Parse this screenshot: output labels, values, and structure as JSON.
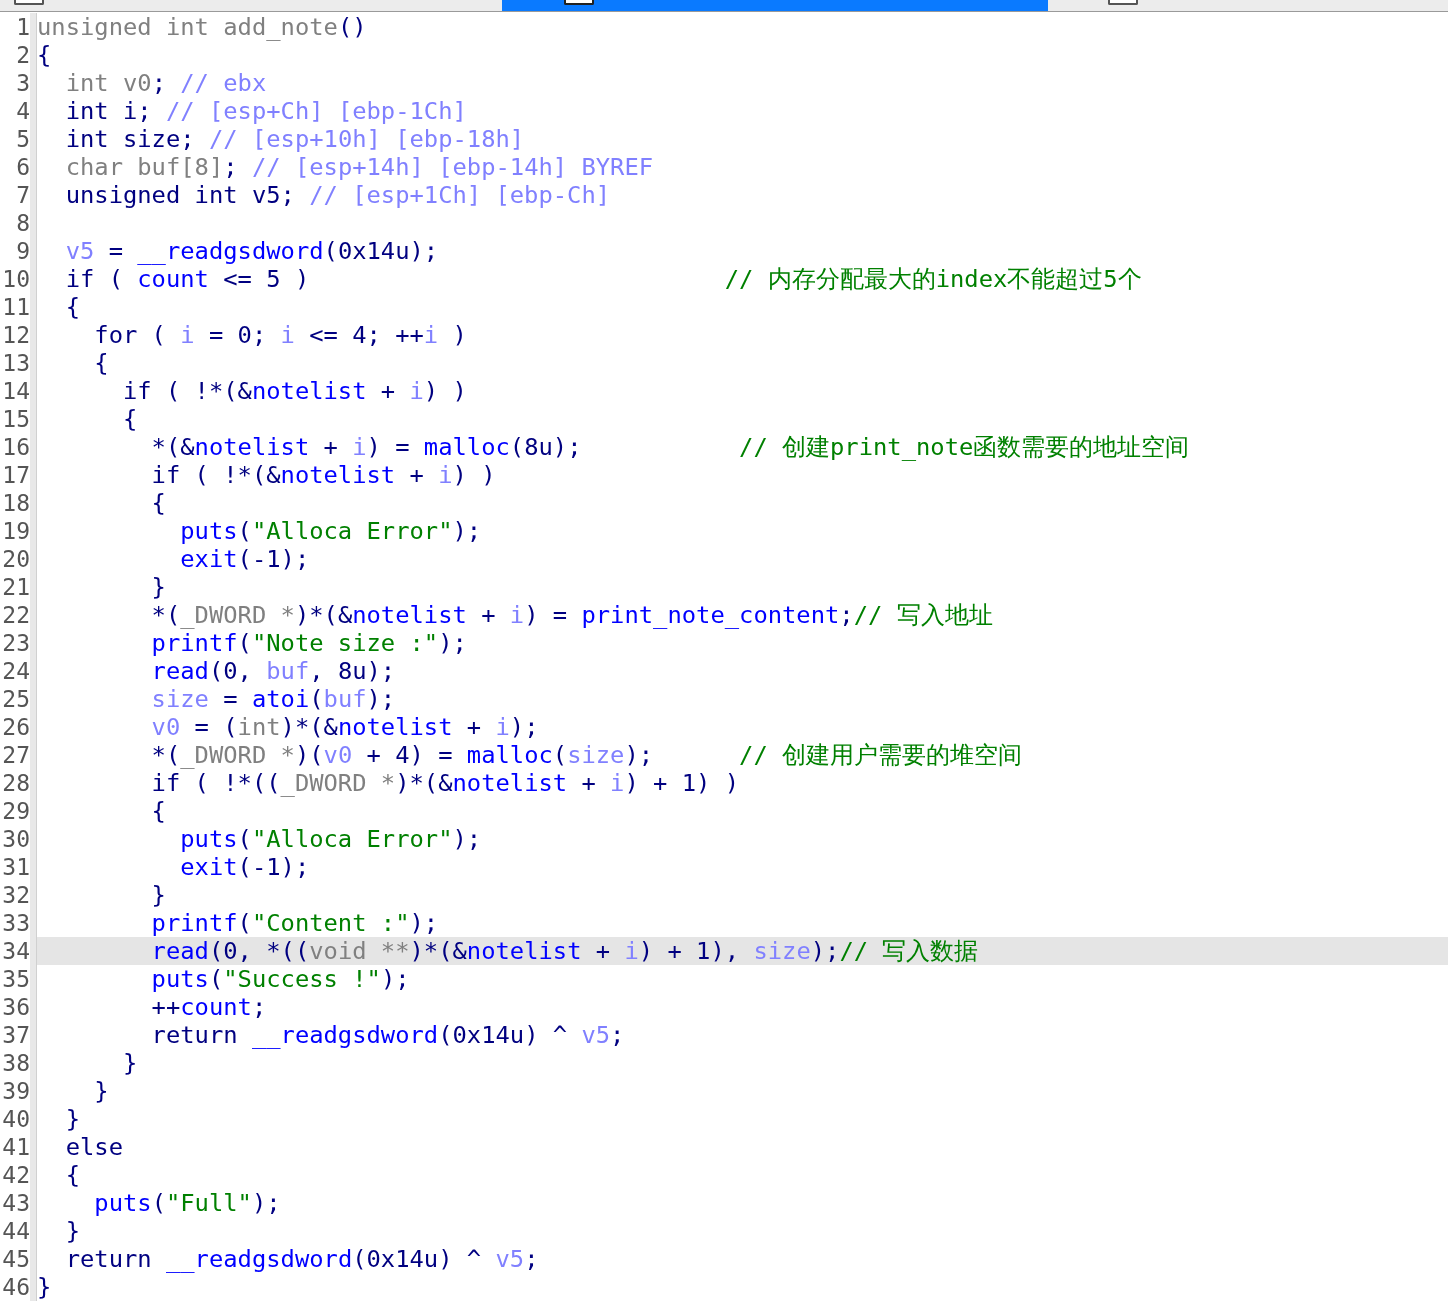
{
  "tabs": [
    {
      "selected": false
    },
    {
      "selected": true
    },
    {
      "selected": false
    }
  ],
  "lines": [
    {
      "n": "1",
      "selected": false,
      "seg": [
        {
          "kind": "type",
          "text": "unsigned int add_note"
        },
        {
          "kind": "plain",
          "text": "()"
        }
      ]
    },
    {
      "n": "2",
      "selected": false,
      "seg": [
        {
          "kind": "plain",
          "text": "{"
        }
      ]
    },
    {
      "n": "3",
      "selected": false,
      "seg": [
        {
          "kind": "type",
          "text": "  int v0"
        },
        {
          "kind": "plain",
          "text": ";"
        },
        {
          "kind": "varcomment",
          "text": " // ebx"
        }
      ]
    },
    {
      "n": "4",
      "selected": false,
      "seg": [
        {
          "kind": "plain",
          "text": "  int i;"
        },
        {
          "kind": "varcomment",
          "text": " // [esp+Ch] [ebp-1Ch]"
        }
      ]
    },
    {
      "n": "5",
      "selected": false,
      "seg": [
        {
          "kind": "plain",
          "text": "  int size;"
        },
        {
          "kind": "varcomment",
          "text": " // [esp+10h] [ebp-18h]"
        }
      ]
    },
    {
      "n": "6",
      "selected": false,
      "seg": [
        {
          "kind": "type",
          "text": "  char buf[8]"
        },
        {
          "kind": "plain",
          "text": ";"
        },
        {
          "kind": "varcomment",
          "text": " // [esp+14h] [ebp-14h] BYREF"
        }
      ]
    },
    {
      "n": "7",
      "selected": false,
      "seg": [
        {
          "kind": "plain",
          "text": "  unsigned int v5;"
        },
        {
          "kind": "varcomment",
          "text": " // [esp+1Ch] [ebp-Ch]"
        }
      ]
    },
    {
      "n": "8",
      "selected": false
    },
    {
      "n": "9",
      "selected": false,
      "seg": [
        {
          "kind": "var",
          "text": "  v5"
        },
        {
          "kind": "plain",
          "text": " = "
        },
        {
          "kind": "fn",
          "text": "__readgsdword"
        },
        {
          "kind": "plain",
          "text": "(0x14u);"
        }
      ]
    },
    {
      "n": "10",
      "selected": false,
      "seg": [
        {
          "kind": "plain",
          "text": "  if ( "
        },
        {
          "kind": "fn",
          "text": "count"
        },
        {
          "kind": "plain",
          "text": " <= 5 )                             "
        },
        {
          "kind": "comment",
          "text": "// 内存分配最大的index不能超过5个"
        }
      ]
    },
    {
      "n": "11",
      "selected": false,
      "seg": [
        {
          "kind": "plain",
          "text": "  {"
        }
      ]
    },
    {
      "n": "12",
      "selected": false,
      "seg": [
        {
          "kind": "plain",
          "text": "    for ( "
        },
        {
          "kind": "var",
          "text": "i"
        },
        {
          "kind": "plain",
          "text": " = 0; "
        },
        {
          "kind": "var",
          "text": "i"
        },
        {
          "kind": "plain",
          "text": " <= 4; ++"
        },
        {
          "kind": "var",
          "text": "i"
        },
        {
          "kind": "plain",
          "text": " )"
        }
      ]
    },
    {
      "n": "13",
      "selected": false,
      "seg": [
        {
          "kind": "plain",
          "text": "    {"
        }
      ]
    },
    {
      "n": "14",
      "selected": false,
      "seg": [
        {
          "kind": "plain",
          "text": "      if ( !*(&"
        },
        {
          "kind": "fn",
          "text": "notelist"
        },
        {
          "kind": "plain",
          "text": " + "
        },
        {
          "kind": "var",
          "text": "i"
        },
        {
          "kind": "plain",
          "text": ") )"
        }
      ]
    },
    {
      "n": "15",
      "selected": false,
      "seg": [
        {
          "kind": "plain",
          "text": "      {"
        }
      ]
    },
    {
      "n": "16",
      "selected": false,
      "seg": [
        {
          "kind": "plain",
          "text": "        *(&"
        },
        {
          "kind": "fn",
          "text": "notelist"
        },
        {
          "kind": "plain",
          "text": " + "
        },
        {
          "kind": "var",
          "text": "i"
        },
        {
          "kind": "plain",
          "text": ") = "
        },
        {
          "kind": "fn",
          "text": "malloc"
        },
        {
          "kind": "plain",
          "text": "(8u);           "
        },
        {
          "kind": "comment",
          "text": "// 创建print_note函数需要的地址空间"
        }
      ]
    },
    {
      "n": "17",
      "selected": false,
      "seg": [
        {
          "kind": "plain",
          "text": "        if ( !*(&"
        },
        {
          "kind": "fn",
          "text": "notelist"
        },
        {
          "kind": "plain",
          "text": " + "
        },
        {
          "kind": "var",
          "text": "i"
        },
        {
          "kind": "plain",
          "text": ") )"
        }
      ]
    },
    {
      "n": "18",
      "selected": false,
      "seg": [
        {
          "kind": "plain",
          "text": "        {"
        }
      ]
    },
    {
      "n": "19",
      "selected": false,
      "seg": [
        {
          "kind": "fn",
          "text": "          puts"
        },
        {
          "kind": "plain",
          "text": "("
        },
        {
          "kind": "string",
          "text": "\"Alloca Error\""
        },
        {
          "kind": "plain",
          "text": ");"
        }
      ]
    },
    {
      "n": "20",
      "selected": false,
      "seg": [
        {
          "kind": "fn",
          "text": "          exit"
        },
        {
          "kind": "plain",
          "text": "(-1);"
        }
      ]
    },
    {
      "n": "21",
      "selected": false,
      "seg": [
        {
          "kind": "plain",
          "text": "        }"
        }
      ]
    },
    {
      "n": "22",
      "selected": false,
      "seg": [
        {
          "kind": "plain",
          "text": "        *("
        },
        {
          "kind": "type",
          "text": "_DWORD *"
        },
        {
          "kind": "plain",
          "text": ")*(&"
        },
        {
          "kind": "fn",
          "text": "notelist"
        },
        {
          "kind": "plain",
          "text": " + "
        },
        {
          "kind": "var",
          "text": "i"
        },
        {
          "kind": "plain",
          "text": ") = "
        },
        {
          "kind": "fn",
          "text": "print_note_content"
        },
        {
          "kind": "plain",
          "text": ";"
        },
        {
          "kind": "comment",
          "text": "// 写入地址"
        }
      ]
    },
    {
      "n": "23",
      "selected": false,
      "seg": [
        {
          "kind": "fn",
          "text": "        printf"
        },
        {
          "kind": "plain",
          "text": "("
        },
        {
          "kind": "string",
          "text": "\"Note size :\""
        },
        {
          "kind": "plain",
          "text": ");"
        }
      ]
    },
    {
      "n": "24",
      "selected": false,
      "seg": [
        {
          "kind": "fn",
          "text": "        read"
        },
        {
          "kind": "plain",
          "text": "(0, "
        },
        {
          "kind": "var",
          "text": "buf"
        },
        {
          "kind": "plain",
          "text": ", 8u);"
        }
      ]
    },
    {
      "n": "25",
      "selected": false,
      "seg": [
        {
          "kind": "var",
          "text": "        size"
        },
        {
          "kind": "plain",
          "text": " = "
        },
        {
          "kind": "fn",
          "text": "atoi"
        },
        {
          "kind": "plain",
          "text": "("
        },
        {
          "kind": "var",
          "text": "buf"
        },
        {
          "kind": "plain",
          "text": ");"
        }
      ]
    },
    {
      "n": "26",
      "selected": false,
      "seg": [
        {
          "kind": "var",
          "text": "        v0"
        },
        {
          "kind": "plain",
          "text": " = ("
        },
        {
          "kind": "type",
          "text": "int"
        },
        {
          "kind": "plain",
          "text": ")*(&"
        },
        {
          "kind": "fn",
          "text": "notelist"
        },
        {
          "kind": "plain",
          "text": " + "
        },
        {
          "kind": "var",
          "text": "i"
        },
        {
          "kind": "plain",
          "text": ");"
        }
      ]
    },
    {
      "n": "27",
      "selected": false,
      "seg": [
        {
          "kind": "plain",
          "text": "        *("
        },
        {
          "kind": "type",
          "text": "_DWORD *"
        },
        {
          "kind": "plain",
          "text": ")("
        },
        {
          "kind": "var",
          "text": "v0"
        },
        {
          "kind": "plain",
          "text": " + 4) = "
        },
        {
          "kind": "fn",
          "text": "malloc"
        },
        {
          "kind": "plain",
          "text": "("
        },
        {
          "kind": "var",
          "text": "size"
        },
        {
          "kind": "plain",
          "text": ");      "
        },
        {
          "kind": "comment",
          "text": "// 创建用户需要的堆空间"
        }
      ]
    },
    {
      "n": "28",
      "selected": false,
      "seg": [
        {
          "kind": "plain",
          "text": "        if ( !*(("
        },
        {
          "kind": "type",
          "text": "_DWORD *"
        },
        {
          "kind": "plain",
          "text": ")*(&"
        },
        {
          "kind": "fn",
          "text": "notelist"
        },
        {
          "kind": "plain",
          "text": " + "
        },
        {
          "kind": "var",
          "text": "i"
        },
        {
          "kind": "plain",
          "text": ") + 1) )"
        }
      ]
    },
    {
      "n": "29",
      "selected": false,
      "seg": [
        {
          "kind": "plain",
          "text": "        {"
        }
      ]
    },
    {
      "n": "30",
      "selected": false,
      "seg": [
        {
          "kind": "fn",
          "text": "          puts"
        },
        {
          "kind": "plain",
          "text": "("
        },
        {
          "kind": "string",
          "text": "\"Alloca Error\""
        },
        {
          "kind": "plain",
          "text": ");"
        }
      ]
    },
    {
      "n": "31",
      "selected": false,
      "seg": [
        {
          "kind": "fn",
          "text": "          exit"
        },
        {
          "kind": "plain",
          "text": "(-1);"
        }
      ]
    },
    {
      "n": "32",
      "selected": false,
      "seg": [
        {
          "kind": "plain",
          "text": "        }"
        }
      ]
    },
    {
      "n": "33",
      "selected": false,
      "seg": [
        {
          "kind": "fn",
          "text": "        printf"
        },
        {
          "kind": "plain",
          "text": "("
        },
        {
          "kind": "string",
          "text": "\"Content :\""
        },
        {
          "kind": "plain",
          "text": ");"
        }
      ]
    },
    {
      "n": "34",
      "selected": true,
      "seg": [
        {
          "kind": "fn",
          "text": "        read"
        },
        {
          "kind": "plain",
          "text": "(0, *(("
        },
        {
          "kind": "type",
          "text": "void **"
        },
        {
          "kind": "plain",
          "text": ")*(&"
        },
        {
          "kind": "fn",
          "text": "notelist"
        },
        {
          "kind": "plain",
          "text": " + "
        },
        {
          "kind": "var",
          "text": "i"
        },
        {
          "kind": "plain",
          "text": ") + 1), "
        },
        {
          "kind": "var",
          "text": "size"
        },
        {
          "kind": "plain",
          "text": ");"
        },
        {
          "kind": "comment",
          "text": "// 写入数据"
        }
      ]
    },
    {
      "n": "35",
      "selected": false,
      "seg": [
        {
          "kind": "fn",
          "text": "        puts"
        },
        {
          "kind": "plain",
          "text": "("
        },
        {
          "kind": "string",
          "text": "\"Success !\""
        },
        {
          "kind": "plain",
          "text": ");"
        }
      ]
    },
    {
      "n": "36",
      "selected": false,
      "seg": [
        {
          "kind": "plain",
          "text": "        ++"
        },
        {
          "kind": "fn",
          "text": "count"
        },
        {
          "kind": "plain",
          "text": ";"
        }
      ]
    },
    {
      "n": "37",
      "selected": false,
      "seg": [
        {
          "kind": "plain",
          "text": "        return "
        },
        {
          "kind": "fn",
          "text": "__readgsdword"
        },
        {
          "kind": "plain",
          "text": "(0x14u) ^ "
        },
        {
          "kind": "var",
          "text": "v5"
        },
        {
          "kind": "plain",
          "text": ";"
        }
      ]
    },
    {
      "n": "38",
      "selected": false,
      "seg": [
        {
          "kind": "plain",
          "text": "      }"
        }
      ]
    },
    {
      "n": "39",
      "selected": false,
      "seg": [
        {
          "kind": "plain",
          "text": "    }"
        }
      ]
    },
    {
      "n": "40",
      "selected": false,
      "seg": [
        {
          "kind": "plain",
          "text": "  }"
        }
      ]
    },
    {
      "n": "41",
      "selected": false,
      "seg": [
        {
          "kind": "plain",
          "text": "  else"
        }
      ]
    },
    {
      "n": "42",
      "selected": false,
      "seg": [
        {
          "kind": "plain",
          "text": "  {"
        }
      ]
    },
    {
      "n": "43",
      "selected": false,
      "seg": [
        {
          "kind": "fn",
          "text": "    puts"
        },
        {
          "kind": "plain",
          "text": "("
        },
        {
          "kind": "string",
          "text": "\"Full\""
        },
        {
          "kind": "plain",
          "text": ");"
        }
      ]
    },
    {
      "n": "44",
      "selected": false,
      "seg": [
        {
          "kind": "plain",
          "text": "  }"
        }
      ]
    },
    {
      "n": "45",
      "selected": false,
      "seg": [
        {
          "kind": "plain",
          "text": "  return "
        },
        {
          "kind": "fn",
          "text": "__readgsdword"
        },
        {
          "kind": "plain",
          "text": "(0x14u) ^ "
        },
        {
          "kind": "var",
          "text": "v5"
        },
        {
          "kind": "plain",
          "text": ";"
        }
      ]
    },
    {
      "n": "46",
      "selected": false,
      "seg": [
        {
          "kind": "plain",
          "text": "}"
        }
      ]
    }
  ]
}
